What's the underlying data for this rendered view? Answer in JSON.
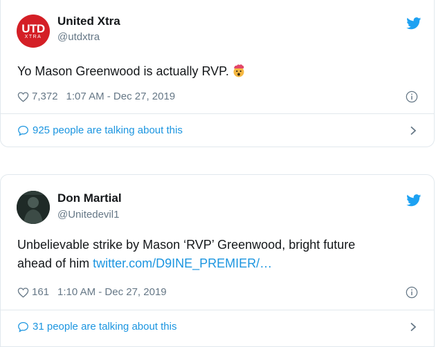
{
  "tweets": [
    {
      "author_name": "United Xtra",
      "author_handle": "@utdxtra",
      "avatar_text_main": "UTD",
      "avatar_text_sub": "XTRA",
      "text": "Yo Mason Greenwood is actually RVP.",
      "emoji_icon": "exploding-head-icon",
      "likes": "7,372",
      "timestamp": "1:07 AM - Dec 27, 2019",
      "talking": "925 people are talking about this"
    },
    {
      "author_name": "Don Martial",
      "author_handle": "@Unitedevil1",
      "text": "Unbelievable strike by Mason ‘RVP’ Greenwood, bright future",
      "text_line2": "ahead of him ",
      "link": "twitter.com/D9INE_PREMIER/…",
      "likes": "161",
      "timestamp": "1:10 AM - Dec 27, 2019",
      "talking": "31 people are talking about this"
    }
  ],
  "colors": {
    "twitter_blue": "#1da1f2",
    "link_blue": "#1b95e0",
    "secondary_text": "#657786",
    "utd_red": "#d41f26"
  }
}
